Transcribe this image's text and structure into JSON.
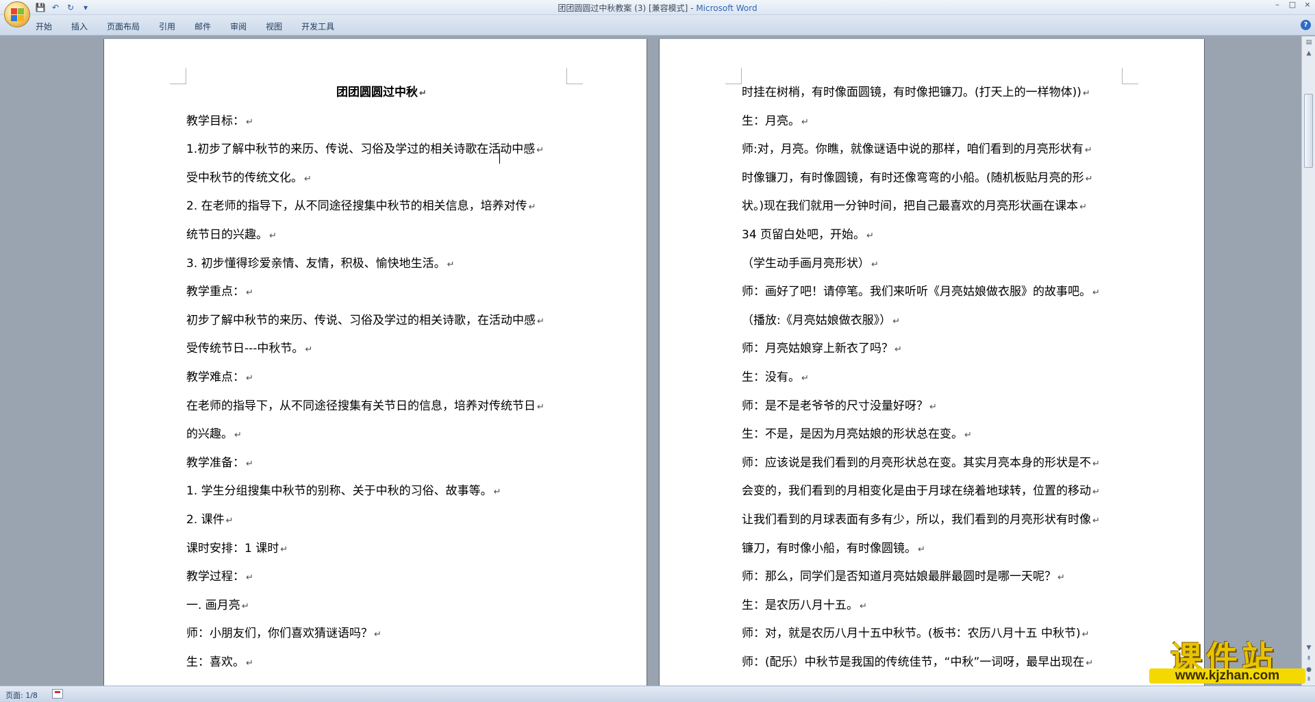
{
  "window": {
    "title_doc": "团团圆圆过中秋教案 (3) [兼容模式] - ",
    "title_app": "Microsoft Word",
    "controls": [
      "–",
      "□",
      "×"
    ]
  },
  "quick_access": {
    "icons": [
      "save-icon",
      "undo-icon",
      "redo-icon",
      "customize-icon"
    ],
    "save": "💾",
    "undo": "↶",
    "redo": "↻",
    "customize": "▾"
  },
  "ribbon": {
    "tabs": [
      "开始",
      "插入",
      "页面布局",
      "引用",
      "邮件",
      "审阅",
      "视图",
      "开发工具"
    ],
    "help": "?"
  },
  "pages": {
    "left": [
      "团团圆圆过中秋",
      "教学目标：",
      "1.初步了解中秋节的来历、传说、习俗及学过的相关诗歌在活动中感",
      "受中秋节的传统文化。",
      "2.  在老师的指导下，从不同途径搜集中秋节的相关信息，培养对传",
      "统节日的兴趣。",
      "3. 初步懂得珍爱亲情、友情，积极、愉快地生活。",
      "教学重点：",
      "初步了解中秋节的来历、传说、习俗及学过的相关诗歌，在活动中感",
      "受传统节日---中秋节。",
      "教学难点：",
      "在老师的指导下，从不同途径搜集有关节日的信息，培养对传统节日",
      "的兴趣。",
      "教学准备：",
      "1. 学生分组搜集中秋节的别称、关于中秋的习俗、故事等。",
      "2. 课件",
      "课时安排：1 课时",
      "教学过程：",
      "一. 画月亮",
      "师：小朋友们，你们喜欢猜谜语吗？",
      "生：喜欢。"
    ],
    "right": [
      "时挂在树梢，有时像面圆镜，有时像把镰刀。(打天上的一样物体))",
      "生：月亮。",
      "师:对，月亮。你瞧，就像谜语中说的那样，咱们看到的月亮形状有",
      "时像镰刀，有时像圆镜，有时还像弯弯的小船。(随机板贴月亮的形",
      "状。)现在我们就用一分钟时间，把自己最喜欢的月亮形状画在课本",
      "34 页留白处吧，开始。",
      "（学生动手画月亮形状）",
      "师：画好了吧！请停笔。我们来听听《月亮姑娘做衣服》的故事吧。",
      "（播放:《月亮姑娘做衣服》）",
      "师：月亮姑娘穿上新衣了吗？",
      "生：没有。",
      "师：是不是老爷爷的尺寸没量好呀？",
      "生：不是，是因为月亮姑娘的形状总在变。",
      "师：应该说是我们看到的月亮形状总在变。其实月亮本身的形状是不",
      "会变的，我们看到的月相变化是由于月球在绕着地球转，位置的移动",
      "让我们看到的月球表面有多有少，所以，我们看到的月亮形状有时像",
      "镰刀，有时像小船，有时像圆镜。",
      "师：那么，同学们是否知道月亮姑娘最胖最圆时是哪一天呢？",
      "生：是农历八月十五。",
      "师：对，就是农历八月十五中秋节。(板书：农历八月十五  中秋节)",
      "师：(配乐）中秋节是我国的传统佳节，“中秋”一词呀，最早出现在"
    ],
    "paragraph_mark": "↵"
  },
  "status": {
    "page": "页面: 1/8"
  },
  "watermark": {
    "text": "课件站",
    "url": "www.kjzhan.com"
  },
  "colors": {
    "app_title": "#3266b6",
    "ribbon_text": "#1e395b",
    "workspace": "#9aa3b0",
    "watermark": "#e8c400"
  }
}
